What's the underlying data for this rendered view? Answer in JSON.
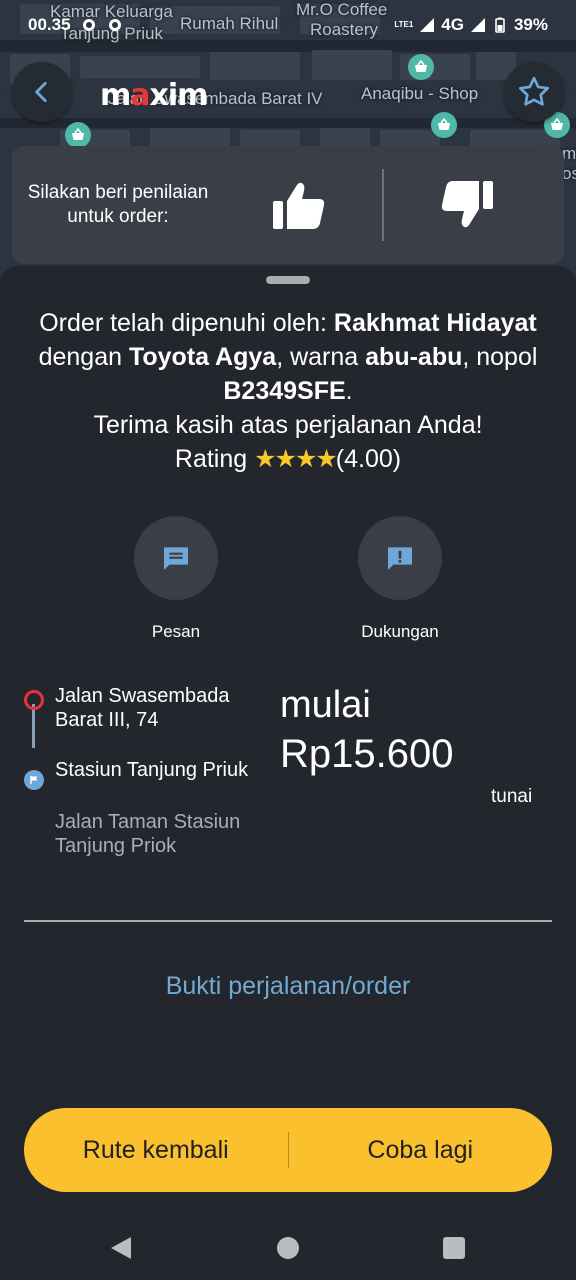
{
  "status_bar": {
    "time": "00.35",
    "network": "4G",
    "volte": "LTE1",
    "battery": "39%"
  },
  "map": {
    "labels": [
      "Kamar Keluarga",
      "Tanjung Priuk",
      "Rumah Rihul",
      "Mr.O Coffee",
      "Roastery",
      "Jalan Swasembada Barat IV",
      "Anaqibu - Shop",
      "Tomb",
      "os"
    ]
  },
  "header": {
    "logo_text": "maxim",
    "back_icon": "chevron-left-icon",
    "favorite_icon": "star-outline-icon"
  },
  "rating_prompt": {
    "text": "Silakan beri penilaian untuk order:",
    "like_icon": "thumbs-up-icon",
    "dislike_icon": "thumbs-down-icon"
  },
  "order": {
    "line1_prefix": "Order telah dipenuhi oleh: ",
    "driver_name": "Rakhmat Hidayat",
    "line2_prefix": "dengan ",
    "car_model": "Toyota Agya",
    "color_prefix": ", warna ",
    "car_color": "abu-abu",
    "plate_prefix": ", nopol",
    "plate": "B2349SFE",
    "plate_suffix": ".",
    "thanks": "Terima kasih atas perjalanan Anda!",
    "rating_label": "Rating ",
    "rating_stars": "★★★★",
    "rating_value": "(4.00)"
  },
  "actions": {
    "message_label": "Pesan",
    "support_label": "Dukungan"
  },
  "route": {
    "from": "Jalan Swasembada Barat III, 74",
    "to_name": "Stasiun Tanjung Priuk",
    "to_address": "Jalan Taman Stasiun Tanjung Priok"
  },
  "price": {
    "prefix": "mulai",
    "amount": "Rp15.600",
    "payment": "tunai"
  },
  "proof_link": "Bukti perjalanan/order",
  "bottom_buttons": {
    "return_route": "Rute kembali",
    "retry": "Coba lagi"
  },
  "colors": {
    "accent_yellow": "#fbc02d",
    "link_blue": "#72a9d2",
    "star_gold": "#f6c92a",
    "origin_red": "#e5323b"
  }
}
